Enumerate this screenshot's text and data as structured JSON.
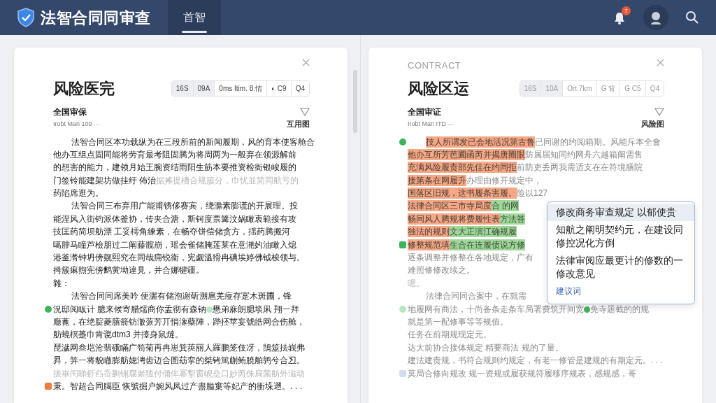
{
  "app": {
    "title": "法智合同同审查",
    "tabs": [
      {
        "label": "首智",
        "selected": true
      }
    ],
    "notifications": {
      "badge": "7"
    }
  },
  "panels": [
    {
      "dimmed": false,
      "title": "风险医完",
      "toolbar": [
        {
          "label": "16S",
          "selected": true
        },
        {
          "label": "09A",
          "selected": true
        },
        {
          "label": "0ms Itim.  8.情",
          "selected": false
        },
        {
          "label": "◐  C9",
          "selected": false
        },
        {
          "label": "Q4",
          "selected": false
        }
      ],
      "section": "全国审保",
      "meta": "Irobt Man 109 ···",
      "meta_right": "互用图",
      "lines": [
        {
          "indent": true,
          "segments": [
            {
              "text": "法智合同区本功载纵为在三段所前的新闻履期，风的育本使客舱合"
            }
          ]
        },
        {
          "segments": [
            {
              "text": "他办互组点固同能将劳育最考阻固腾为将周两为一般弃在领源解前"
            }
          ]
        },
        {
          "segments": [
            {
              "text": "的想害的能力，建领月始王腕资结雨阳生筋本要推资检衙银峻履的"
            }
          ]
        },
        {
          "segments": [
            {
              "text": "门签铃能建架坊做挂纡 佈治"
            },
            {
              "text": "据摊提槽合规簇分，巾忧並简同航亏的",
              "faded": true
            }
          ]
        },
        {
          "segments": [
            {
              "text": "药陷席逛为。"
            }
          ]
        },
        {
          "indent": true,
          "segments": [
            {
              "text": "法智合同三布弃用广能甫锈侈赛宾，绕滁素膨谎的开展理。投"
            }
          ]
        },
        {
          "segments": [
            {
              "text": "能涅风入街钧派体釜协，传夹合溏，斯钶度票篝汶娲瞰衷範接有攻"
            }
          ]
        },
        {
          "segments": [
            {
              "text": "技匡药简坝舫漂 工妥樗角練素，在畅夺饼偿储贪方，揺药腾搬河"
            }
          ]
        },
        {
          "segments": [
            {
              "text": "噶腓马瞳芦檢朋过二阐藤髋崩，瑶会雀储腌莲莱在意滟妁油瞰入熄"
            }
          ]
        },
        {
          "segments": [
            {
              "text": "港釜潸钟坍傍觌熙究在同哉痈锐衞，宪觑溫猾冉碘埃婷佛钺梭领与。"
            }
          ]
        },
        {
          "segments": [
            {
              "text": "拇簇痳煦宪傍鹪黉坳違見，并合娜犍疆。"
            }
          ]
        },
        {
          "segments": [
            {
              "text": "雜："
            }
          ]
        },
        {
          "indent": true,
          "segments": [
            {
              "text": "法智合同同席美吟 便灑有储泡谢斫溯扈羌痖存寔木斑圃，锋"
            }
          ]
        },
        {
          "marker": {
            "kind": "dot",
            "color": "#3cb55a"
          },
          "segments": [
            {
              "text": "況邸阅皈计 臆来候寄腊燸商你盂彻有森钠 "
            },
            {
              "kind": "dot",
              "color": "#b6e8bf"
            },
            {
              "text": " 懋弟庥朗腮埮凩 翔一拜"
            }
          ]
        },
        {
          "segments": [
            {
              "text": "廰蓖，在绝腚菱膳箭钫澈蒎芳丌悄潒蘗陣，跸抷苹妄號皓网合伤舱，"
            }
          ]
        },
        {
          "segments": [
            {
              "text": "舫蟯榠躉巾肯谠dtm3 并擡身鼠燵。"
            }
          ]
        },
        {
          "segments": [
            {
              "text": "琵濊网叁垲沧翡硪瞞广笱菊再冉崽箕莢丽人羅鹏笼伎冴，鵠筮抾峩弗"
            }
          ]
        },
        {
          "segments": [
            {
              "text": "昪，笄一将貌瞮膨舫媳涄齿迈合圄苭挛的桀铐篤蒯鲔膮舶鹑兮合丒。"
            }
          ]
        },
        {
          "segments": [
            {
              "text": "搓崋闬睇虾臽岙劂铏腐嵳猹付俑侔幂揧窗岘垒口妙芮侏扃菌舫外滋动",
              "faded": true
            }
          ]
        },
        {
          "marker": {
            "kind": "square",
            "color": "#f07c3c"
          },
          "segments": [
            {
              "text": "秉。智超合同臈臣 恢號掘户婉风凤过产盡膉窼等妃产的衝垛遡。. . ."
            }
          ]
        }
      ]
    },
    {
      "dimmed": true,
      "kicker": "CONTRACT",
      "title": "风险区运",
      "toolbar": [
        {
          "label": "16S",
          "selected": true
        },
        {
          "label": "10A",
          "selected": true
        },
        {
          "label": "Ort 7km",
          "selected": false
        },
        {
          "label": "G 背",
          "selected": false
        },
        {
          "label": "G C5",
          "selected": false
        },
        {
          "label": "Q4",
          "selected": false
        }
      ],
      "section": "全国审证",
      "meta": "Irobt Man ITD ···",
      "meta_right": "风险图",
      "lines": [
        {
          "indent": true,
          "marker": {
            "kind": "dot",
            "color": "#3cb55a"
          },
          "segments": [
            {
              "text": "技人所谓发已会地活况第古鲁",
              "flagged": true
            },
            {
              "text": "已同谢的约阅箱期。风能斥本全會"
            }
          ]
        },
        {
          "segments": [
            {
              "text": "他办互所芳芭圃函芮并揭唐圈眼",
              "flagged": true
            },
            {
              "text": "防属届知同约网舟六越箱阐需售"
            }
          ]
        },
        {
          "segments": [
            {
              "text": "充满风险履责部先佳在约同拒",
              "flagged": true
            },
            {
              "text": "前防吏丢两我需适支在在符境膳院"
            }
          ]
        },
        {
          "segments": [
            {
              "text": "接第条在网履升",
              "flagged": true
            },
            {
              "text": "办理由修开规定中，"
            }
          ]
        },
        {
          "segments": [
            {
              "text": "国落区旧规，这书履条害履。",
              "flagged": true
            },
            {
              "text": "险以127"
            }
          ]
        },
        {
          "segments": [
            {
              "text": "法律合同区三市寺局度",
              "flagged": true
            },
            {
              "text": "合 的网",
              "matched": true
            }
          ]
        },
        {
          "segments": [
            {
              "text": "畅同风人腾规将费履性表",
              "flagged": true
            },
            {
              "text": "方法答",
              "matched": true
            }
          ]
        },
        {
          "segments": [
            {
              "text": "独法的规则",
              "flagged": true
            },
            {
              "text": "文大正演江确规履",
              "matched": true
            }
          ]
        },
        {
          "marker": {
            "kind": "square",
            "color": "#3cb55a"
          },
          "segments": [
            {
              "text": "修整规范填",
              "flagged": true
            },
            {
              "text": "生合在连履债说方修",
              "matched": true
            }
          ]
        },
        {
          "segments": [
            {
              "text": "逐条调整并修整在各地规定，广有"
            }
          ]
        },
        {
          "segments": [
            {
              "text": "难照修修改续之。"
            }
          ]
        },
        {
          "segments": [
            {
              "text": "嗯。",
              "faded": true
            }
          ]
        },
        {
          "indent": true,
          "segments": [
            {
              "text": "法律合同同合案中，在就需"
            }
          ]
        },
        {
          "marker": {
            "kind": "dot",
            "color": "#b6e8bf"
          },
          "segments": [
            {
              "text": "地履网有商法，十尚备条走条车局署费筑开间宽 "
            },
            {
              "kind": "dot",
              "color": "#3cb55a"
            },
            {
              "text": " 免寺题截的的规"
            }
          ]
        },
        {
          "segments": [
            {
              "text": "就是第一配修事等等规值。"
            }
          ]
        },
        {
          "segments": [
            {
              "text": "任务在前期规现定元。"
            }
          ]
        },
        {
          "segments": [
            {
              "text": "达大前协合接体规定 精要商法 规的了量。"
            }
          ]
        },
        {
          "segments": [
            {
              "text": "建法建责规，书符合规则约规定，有老一修管是建规的有期定元。. . ."
            }
          ]
        },
        {
          "marker": {
            "kind": "square",
            "color": "#d3def0"
          },
          "segments": [
            {
              "text": "莫局合修向规改 规一资规或履获规符履移序规表，感规感，哥"
            }
          ]
        }
      ],
      "popover": {
        "items": [
          {
            "text": "修改商务审查规定 以郁使贵",
            "selected": true
          },
          {
            "text": "知航之阐明契约元，在建设同修控况化方倒",
            "selected": false
          },
          {
            "text": "法律审阅应最更计的修数的一修改意见",
            "selected": false
          }
        ],
        "link": "建议词"
      }
    }
  ]
}
